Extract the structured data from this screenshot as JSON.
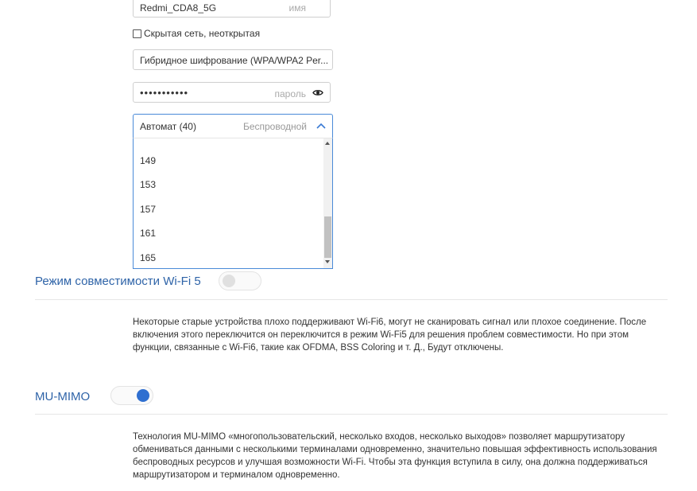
{
  "ssid": {
    "value": "Redmi_CDA8_5G",
    "placeholder": "имя"
  },
  "hidden_network": {
    "label": "Скрытая сеть, неоткрытая",
    "checked": false
  },
  "encryption": {
    "value": "Гибридное шифрование (WPA/WPA2 Per..."
  },
  "password": {
    "value": "•••••••••••",
    "placeholder": "пароль"
  },
  "channel": {
    "value": "Автомат (40)",
    "hint": "Беспроводной",
    "options": [
      "149",
      "153",
      "157",
      "161",
      "165"
    ]
  },
  "wifi5_compat": {
    "title": "Режим совместимости Wi-Fi 5",
    "enabled": false,
    "description": "Некоторые старые устройства плохо поддерживают Wi-Fi6, могут не сканировать сигнал или плохое соединение. После включения этого переключится он переключится в режим Wi-Fi5 для решения проблем совместимости. Но при этом функции, связанные с Wi-Fi6, такие как OFDMA, BSS Coloring и т. Д., Будут отключены."
  },
  "mu_mimo": {
    "title": "MU-MIMO",
    "enabled": true,
    "description": "Технология MU-MIMO «многопользовательский, несколько входов, несколько выходов» позволяет маршрутизатору обмениваться данными с несколькими терминалами одновременно, значительно повышая эффективность использования беспроводных ресурсов и улучшая возможности Wi-Fi. Чтобы эта функция вступила в силу, она должна поддерживаться маршрутизатором и терминалом одновременно."
  },
  "colors": {
    "accent": "#2f64a8",
    "toggle_on": "#2f6fd0",
    "focus_border": "#4a8ad8"
  }
}
